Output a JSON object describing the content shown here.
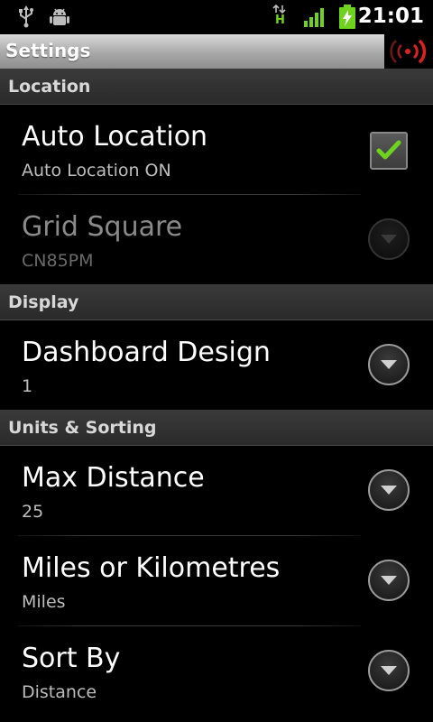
{
  "status_bar": {
    "time": "21:01",
    "network_label": "H",
    "icons": [
      "usb-icon",
      "android-debug-icon",
      "network-data-icon",
      "signal-bars-icon",
      "battery-charging-icon"
    ]
  },
  "title_bar": {
    "title": "Settings",
    "signal_icon": "broadcast-signal-icon"
  },
  "colors": {
    "accent_green": "#6fd21f",
    "broadcast_red": "#e02020"
  },
  "sections": [
    {
      "header": "Location",
      "items": [
        {
          "title": "Auto Location",
          "summary": "Auto Location ON",
          "widget": "checkbox",
          "checked": true,
          "enabled": true
        },
        {
          "title": "Grid Square",
          "summary": "CN85PM",
          "widget": "dropdown",
          "enabled": false
        }
      ]
    },
    {
      "header": "Display",
      "items": [
        {
          "title": "Dashboard Design",
          "summary": "1",
          "widget": "dropdown",
          "enabled": true
        }
      ]
    },
    {
      "header": "Units & Sorting",
      "items": [
        {
          "title": "Max Distance",
          "summary": "25",
          "widget": "dropdown",
          "enabled": true
        },
        {
          "title": "Miles or Kilometres",
          "summary": "Miles",
          "widget": "dropdown",
          "enabled": true
        },
        {
          "title": "Sort By",
          "summary": "Distance",
          "widget": "dropdown",
          "enabled": true
        }
      ]
    }
  ]
}
